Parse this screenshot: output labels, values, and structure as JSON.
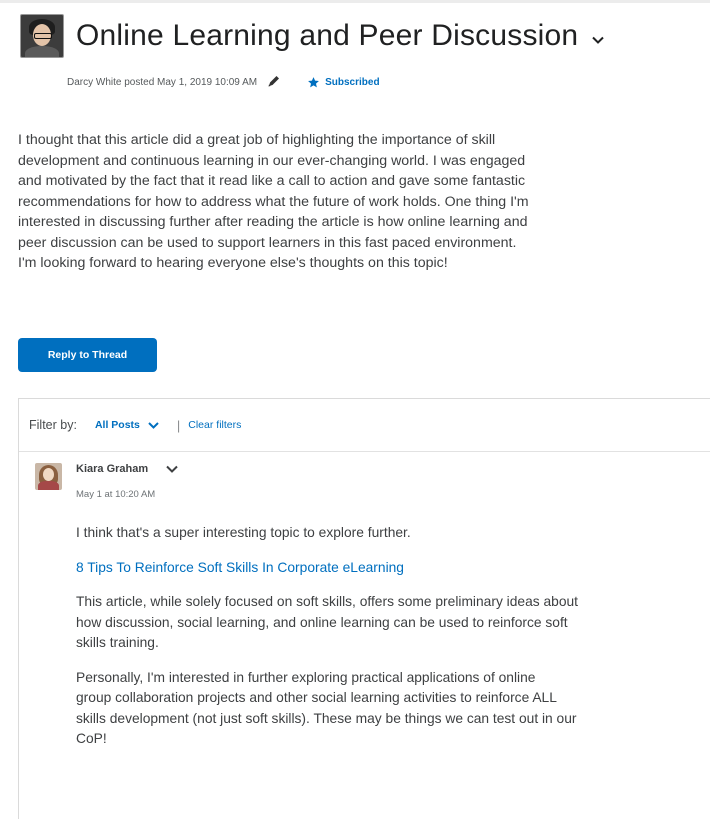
{
  "thread": {
    "title": "Online Learning and Peer Discussion",
    "meta": "Darcy White posted May 1, 2019 10:09 AM",
    "subscribed_label": "Subscribed",
    "body_lines": [
      "I thought that this article did a great job of highlighting the importance of skill",
      "development and continuous learning in our ever-changing world. I was engaged",
      "and motivated by the fact that it read like a call to action and gave some fantastic",
      "recommendations for how to address what the future of work holds. One thing I'm",
      "interested in discussing further after reading the article is how online learning and",
      "peer discussion can be used to support learners in this fast paced environment.",
      "I'm looking forward to hearing everyone else's thoughts on this topic!"
    ],
    "reply_button": "Reply to Thread"
  },
  "filter": {
    "label": "Filter by:",
    "selected": "All Posts",
    "separator": "|",
    "clear_label": "Clear filters"
  },
  "reply": {
    "author": "Kiara Graham",
    "date": "May 1 at 10:20 AM",
    "intro": "I think that's a super interesting topic to explore further.",
    "link_text": "8 Tips To Reinforce Soft Skills In Corporate eLearning",
    "para1_lines": [
      "This article, while solely focused on soft skills, offers some preliminary ideas about",
      "how discussion, social learning, and online learning can be used to reinforce soft",
      "skills training."
    ],
    "para2_lines": [
      "Personally, I'm interested in further exploring practical applications of online",
      "group collaboration projects and other social learning activities to reinforce ALL",
      "skills development (not just soft skills). These may be things we can test out in our",
      "CoP!"
    ]
  },
  "colors": {
    "link": "#006fbf",
    "primary_button": "#006fbf",
    "text": "#3e4042"
  }
}
